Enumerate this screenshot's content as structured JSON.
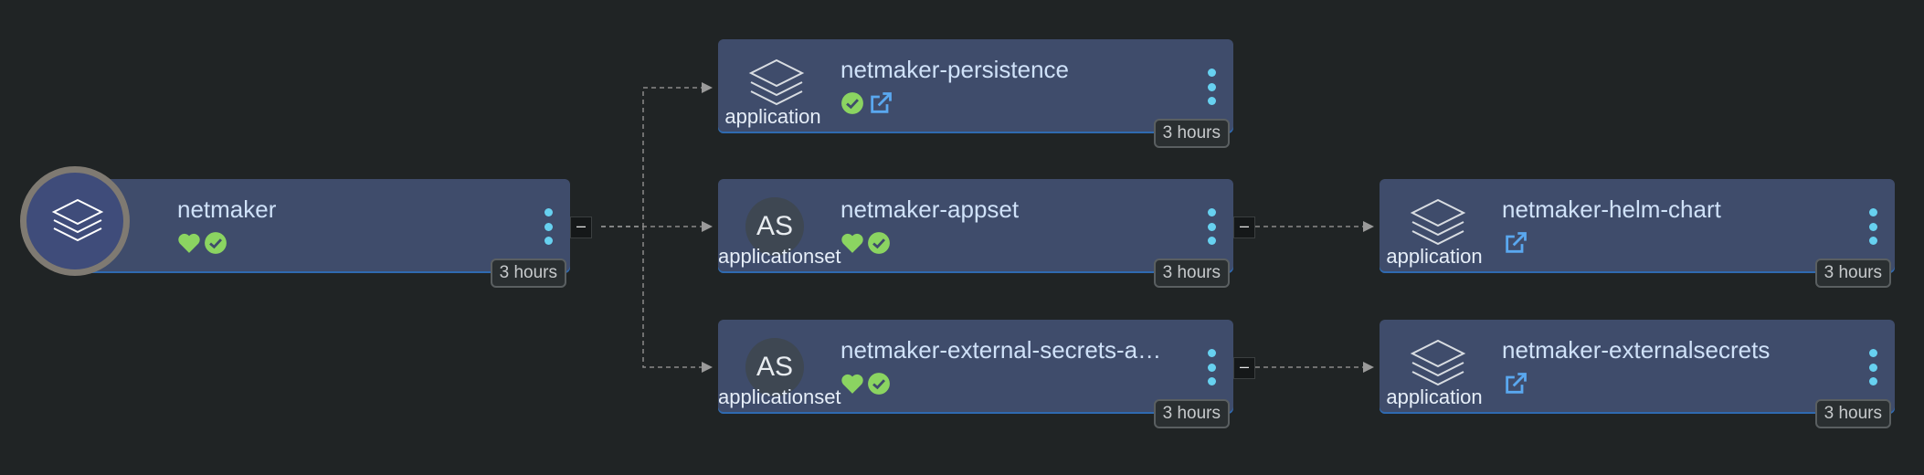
{
  "nodes": {
    "root": {
      "title": "netmaker",
      "age": "3 hours",
      "status_icons": [
        "heart-icon",
        "check-circle-icon"
      ]
    },
    "persistence": {
      "title": "netmaker-persistence",
      "kind": "application",
      "age": "3 hours",
      "status_icons": [
        "check-circle-icon",
        "external-link-icon"
      ]
    },
    "appset": {
      "title": "netmaker-appset",
      "kind": "applicationset",
      "avatar": "AS",
      "age": "3 hours",
      "status_icons": [
        "heart-icon",
        "check-circle-icon"
      ]
    },
    "external_appset": {
      "title": "netmaker-external-secrets-ap…",
      "kind": "applicationset",
      "avatar": "AS",
      "age": "3 hours",
      "status_icons": [
        "heart-icon",
        "check-circle-icon"
      ]
    },
    "helm_chart": {
      "title": "netmaker-helm-chart",
      "kind": "application",
      "age": "3 hours",
      "status_icons": [
        "external-link-icon"
      ]
    },
    "externalsecrets": {
      "title": "netmaker-externalsecrets",
      "kind": "application",
      "age": "3 hours",
      "status_icons": [
        "external-link-icon"
      ]
    }
  },
  "collapse_label": "–",
  "colors": {
    "background": "#202425",
    "node": "#3f4c6b",
    "healthy_green": "#8bd461",
    "link_blue": "#5aa8f0",
    "menu_dots": "#67d1f0",
    "edge": "#8a8a8a"
  }
}
